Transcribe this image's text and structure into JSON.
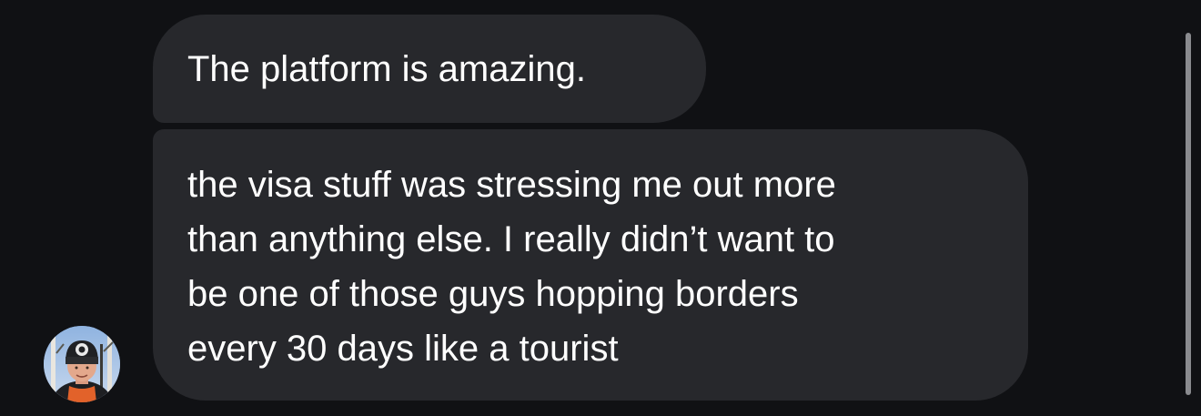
{
  "messages": [
    {
      "text": "The platform is amazing."
    },
    {
      "lines": [
        "the visa stuff was stressing me out more",
        "than anything else. I really didn’t want to",
        "be one of those guys hopping borders",
        "every 30 days like a tourist"
      ]
    }
  ],
  "sender": {
    "avatar_icon": "user-photo-avatar"
  },
  "colors": {
    "background": "#101114",
    "bubble": "#27282c",
    "text": "#ffffff"
  }
}
